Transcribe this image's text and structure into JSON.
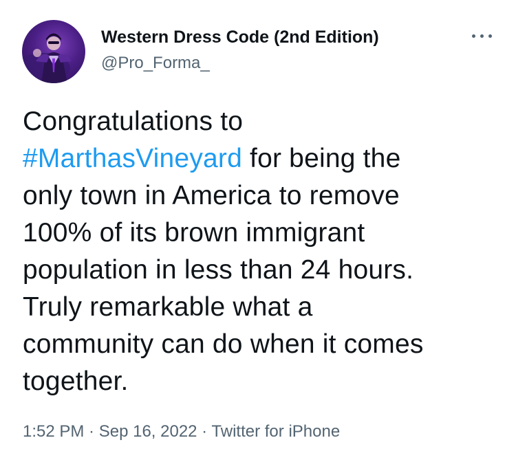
{
  "author": {
    "display_name": "Western Dress Code (2nd Edition)",
    "handle": "@Pro_Forma_",
    "avatar_icon": "profile-avatar"
  },
  "more_icon": "more-options-icon",
  "tweet": {
    "line1": "Congratulations to",
    "hashtag": "#MarthasVineyard",
    "line2_rest": " for being the",
    "line3": "only town in America to remove",
    "line4": "100% of its brown immigrant",
    "line5": "population in less than 24 hours.",
    "line6": "Truly remarkable what a",
    "line7": "community can do when it comes",
    "line8": "together."
  },
  "meta": {
    "time": "1:52 PM",
    "sep1": " · ",
    "date": "Sep 16, 2022",
    "sep2": " · ",
    "source": "Twitter for iPhone"
  },
  "colors": {
    "hashtag": "#1d9bf0",
    "secondary_text": "#536471",
    "primary_text": "#0f1419",
    "avatar_bg": "#4b1f86"
  }
}
